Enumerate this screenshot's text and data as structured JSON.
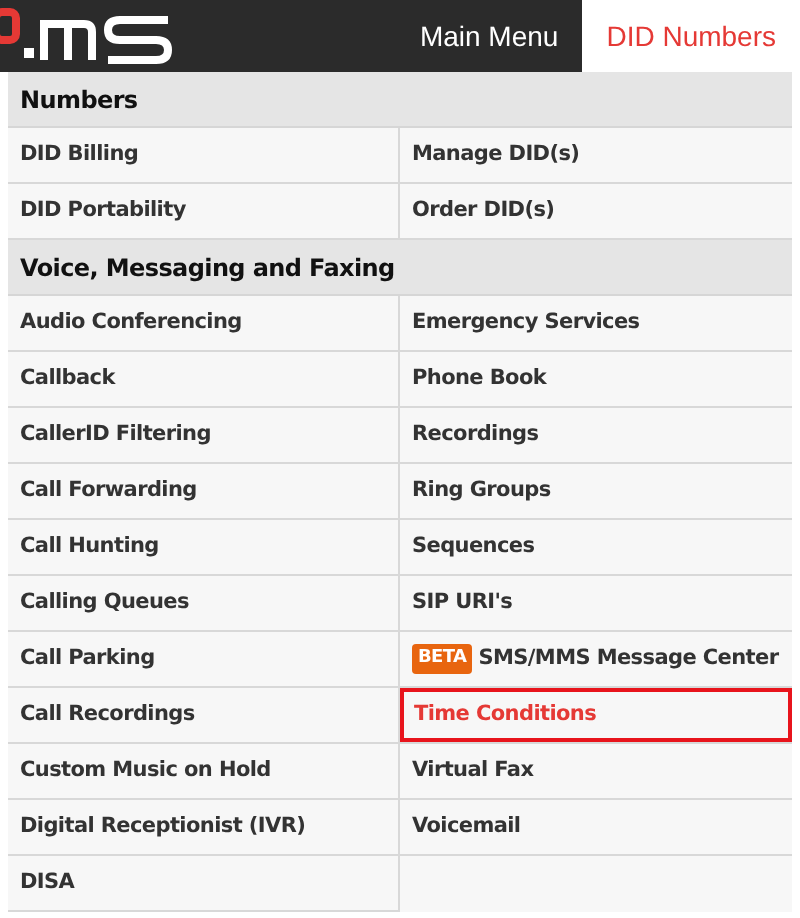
{
  "header": {
    "tabs": [
      {
        "label": "Main Menu",
        "selected": false
      },
      {
        "label": "DID Numbers",
        "selected": true
      }
    ]
  },
  "sections": [
    {
      "title": "Numbers",
      "items": [
        {
          "label": "DID Billing",
          "selected": false
        },
        {
          "label": "Manage DID(s)",
          "selected": false
        },
        {
          "label": "DID Portability",
          "selected": false
        },
        {
          "label": "Order DID(s)",
          "selected": false
        }
      ]
    },
    {
      "title": "Voice, Messaging and Faxing",
      "items": [
        {
          "label": "Audio Conferencing",
          "selected": false
        },
        {
          "label": "Emergency Services",
          "selected": false
        },
        {
          "label": "Callback",
          "selected": false
        },
        {
          "label": "Phone Book",
          "selected": false
        },
        {
          "label": "CallerID Filtering",
          "selected": false
        },
        {
          "label": "Recordings",
          "selected": false
        },
        {
          "label": "Call Forwarding",
          "selected": false
        },
        {
          "label": "Ring Groups",
          "selected": false
        },
        {
          "label": "Call Hunting",
          "selected": false
        },
        {
          "label": "Sequences",
          "selected": false
        },
        {
          "label": "Calling Queues",
          "selected": false
        },
        {
          "label": "SIP URI's",
          "selected": false
        },
        {
          "label": "Call Parking",
          "selected": false
        },
        {
          "label": "SMS/MMS Message Center",
          "selected": false,
          "badge": "BETA"
        },
        {
          "label": "Call Recordings",
          "selected": false
        },
        {
          "label": "Time Conditions",
          "selected": true
        },
        {
          "label": "Custom Music on Hold",
          "selected": false
        },
        {
          "label": "Virtual Fax",
          "selected": false
        },
        {
          "label": "Digital Receptionist (IVR)",
          "selected": false
        },
        {
          "label": "Voicemail",
          "selected": false
        },
        {
          "label": "DISA",
          "selected": false
        }
      ]
    }
  ]
}
